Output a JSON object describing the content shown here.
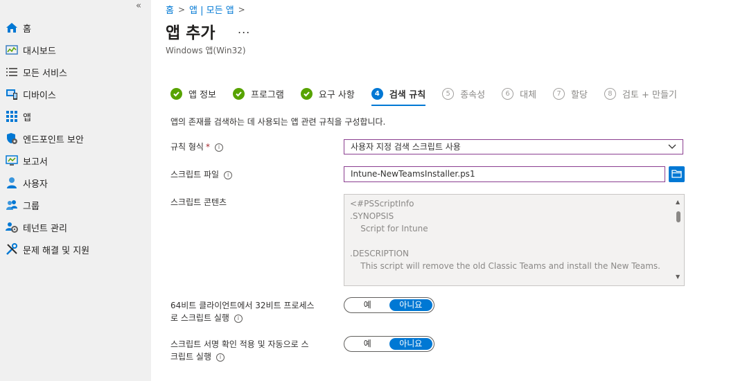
{
  "sidebar": {
    "collapse_glyph": "«",
    "items": [
      {
        "label": "홈",
        "icon": "home-icon"
      },
      {
        "label": "대시보드",
        "icon": "dashboard-icon"
      },
      {
        "label": "모든 서비스",
        "icon": "list-icon"
      },
      {
        "label": "디바이스",
        "icon": "device-icon"
      },
      {
        "label": "앱",
        "icon": "apps-grid-icon"
      },
      {
        "label": "엔드포인트 보안",
        "icon": "shield-icon"
      },
      {
        "label": "보고서",
        "icon": "report-icon"
      },
      {
        "label": "사용자",
        "icon": "user-icon"
      },
      {
        "label": "그룹",
        "icon": "group-icon"
      },
      {
        "label": "테넌트 관리",
        "icon": "tenant-gear-icon"
      },
      {
        "label": "문제 해결 및 지원",
        "icon": "tools-icon"
      }
    ]
  },
  "breadcrumb": [
    "홈",
    "앱 | 모든 앱"
  ],
  "header": {
    "title": "앱 추가",
    "more": "...",
    "subtitle": "Windows 앱(Win32)"
  },
  "steps": [
    {
      "label": "앱 정보",
      "state": "done"
    },
    {
      "label": "프로그램",
      "state": "done"
    },
    {
      "label": "요구 사항",
      "state": "done"
    },
    {
      "num": "4",
      "label": "검색 규칙",
      "state": "current"
    },
    {
      "num": "5",
      "label": "종속성",
      "state": "future"
    },
    {
      "num": "6",
      "label": "대체",
      "state": "future"
    },
    {
      "num": "7",
      "label": "할당",
      "state": "future"
    },
    {
      "num": "8",
      "label": "검토 + 만들기",
      "state": "future"
    }
  ],
  "form": {
    "description": "앱의 존재를 검색하는 데 사용되는 앱 관련 규칙을 구성합니다.",
    "rule_type": {
      "label": "규칙 형식",
      "required": "*",
      "value": "사용자 지정 검색 스크립트 사용"
    },
    "script_file": {
      "label": "스크립트 파일",
      "value": "Intune-NewTeamsInstaller.ps1"
    },
    "script_content": {
      "label": "스크립트 콘텐츠",
      "lines": [
        "<#PSScriptInfo",
        ".SYNOPSIS",
        "    Script for Intune",
        "",
        ".DESCRIPTION",
        "    This script will remove the old Classic Teams and install the New Teams."
      ]
    },
    "run_32bit": {
      "label_line1": "64비트 클라이언트에서 32비트 프로세스",
      "label_line2": "로 스크립트 실행",
      "yes": "예",
      "no": "아니요",
      "selected": "no"
    },
    "signature_check": {
      "label_line1": "스크립트 서명 확인 적용 및 자동으로 스",
      "label_line2": "크립트 실행",
      "yes": "예",
      "no": "아니요",
      "selected": "no"
    }
  },
  "colors": {
    "accent": "#0078d4",
    "done": "#57a300",
    "sidebar_bg": "#f0f0f0",
    "field_border": "#8a3d8f"
  }
}
